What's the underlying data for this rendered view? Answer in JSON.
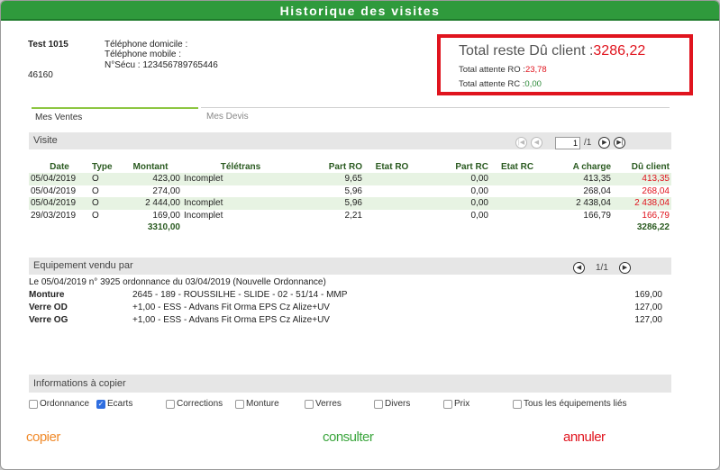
{
  "window": {
    "title": "Historique des visites"
  },
  "patient": {
    "name": "Test 1015",
    "code": "46160",
    "phone_home_label": "Téléphone domicile :",
    "phone_mobile_label": "Téléphone mobile :",
    "secu_label": "N°Sécu :",
    "secu_value": "123456789765446"
  },
  "totals": {
    "reste_label": "Total reste Dû client :",
    "reste_value": "3286,22",
    "ro_label": "Total attente RO :",
    "ro_value": "23,78",
    "rc_label": "Total attente RC :",
    "rc_value": "0,00",
    "colors": {
      "highlight": "#e0141e",
      "rc": "#2e8b3a"
    }
  },
  "tabs": [
    {
      "label": "Mes Ventes",
      "active": true
    },
    {
      "label": "Mes Devis",
      "active": false
    }
  ],
  "visite": {
    "section_title": "Visite",
    "pager": {
      "current": "1",
      "total": "/1"
    },
    "columns": [
      "Date",
      "Type",
      "Montant",
      "Télétrans",
      "Part RO",
      "Etat RO",
      "Part RC",
      "Etat RC",
      "A charge",
      "Dû client"
    ],
    "rows": [
      {
        "date": "05/04/2019",
        "type": "O",
        "montant": "423,00",
        "teletrans": "Incomplet",
        "part_ro": "9,65",
        "etat_ro": "",
        "part_rc": "0,00",
        "etat_rc": "",
        "a_charge": "413,35",
        "du_client": "413,35"
      },
      {
        "date": "05/04/2019",
        "type": "O",
        "montant": "274,00",
        "teletrans": "",
        "part_ro": "5,96",
        "etat_ro": "",
        "part_rc": "0,00",
        "etat_rc": "",
        "a_charge": "268,04",
        "du_client": "268,04"
      },
      {
        "date": "05/04/2019",
        "type": "O",
        "montant": "2 444,00",
        "teletrans": "Incomplet",
        "part_ro": "5,96",
        "etat_ro": "",
        "part_rc": "0,00",
        "etat_rc": "",
        "a_charge": "2 438,04",
        "du_client": "2 438,04"
      },
      {
        "date": "29/03/2019",
        "type": "O",
        "montant": "169,00",
        "teletrans": "Incomplet",
        "part_ro": "2,21",
        "etat_ro": "",
        "part_rc": "0,00",
        "etat_rc": "",
        "a_charge": "166,79",
        "du_client": "166,79"
      }
    ],
    "total_montant": "3310,00",
    "total_du_client": "3286,22",
    "row_highlight_color": "#e7f3e3"
  },
  "equipement": {
    "section_title": "Equipement vendu par",
    "pager": "1/1",
    "ordonnance_line": "Le 05/04/2019 n° 3925 ordonnance du 03/04/2019 (Nouvelle Ordonnance)",
    "items": [
      {
        "label": "Monture",
        "description": "2645 - 189 - ROUSSILHE - SLIDE - 02 - 51/14 - MMP",
        "price": "169,00"
      },
      {
        "label": "Verre OD",
        "description": "+1,00 - ESS - Advans Fit Orma EPS Cz Alize+UV",
        "price": "127,00"
      },
      {
        "label": "Verre OG",
        "description": "+1,00 - ESS - Advans Fit Orma EPS Cz Alize+UV",
        "price": "127,00"
      }
    ]
  },
  "copy": {
    "section_title": "Informations à copier",
    "options": [
      {
        "label": "Ordonnance",
        "checked": false
      },
      {
        "label": "Ecarts",
        "checked": true
      },
      {
        "label": "Corrections",
        "checked": false
      },
      {
        "label": "Monture",
        "checked": false
      },
      {
        "label": "Verres",
        "checked": false
      },
      {
        "label": "Divers",
        "checked": false
      },
      {
        "label": "Prix",
        "checked": false
      },
      {
        "label": "Tous les équipements liés",
        "checked": false
      }
    ]
  },
  "actions": {
    "copier": "copier",
    "consulter": "consulter",
    "annuler": "annuler",
    "colors": {
      "copier": "#f08a2a",
      "consulter": "#3aa53c",
      "annuler": "#e0141e"
    }
  }
}
